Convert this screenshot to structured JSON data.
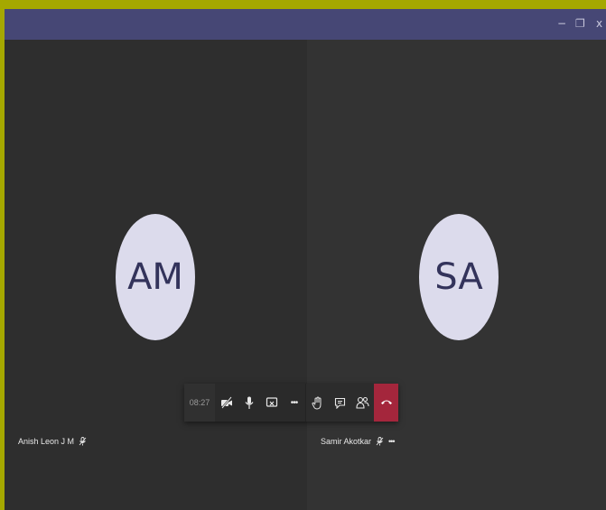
{
  "window": {
    "controls": {
      "minimize": "−",
      "restore": "❐",
      "close": "x"
    }
  },
  "participants": [
    {
      "initials": "AM",
      "name": "Anish Leon J M",
      "muted": true
    },
    {
      "initials": "SA",
      "name": "Samir Akotkar",
      "muted": true,
      "more": "•••"
    }
  ],
  "call_controls": {
    "duration": "08:27",
    "more_label": "•••",
    "hangup_color": "#a4263c"
  },
  "colors": {
    "titlebar": "#464775",
    "avatar_bg": "#dcdbec",
    "avatar_text": "#33335b",
    "frame": "#a5a800"
  }
}
